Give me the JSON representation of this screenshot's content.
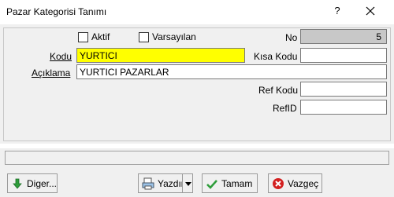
{
  "window": {
    "title": "Pazar Kategorisi Tanımı",
    "help_label": "?"
  },
  "form": {
    "aktif": {
      "label": "Aktif",
      "checked": false
    },
    "varsayilan": {
      "label": "Varsayılan",
      "checked": false
    },
    "no": {
      "label": "No",
      "value": "5"
    },
    "kodu": {
      "label": "Kodu",
      "value": "YURTICI"
    },
    "kisa_kodu": {
      "label": "Kısa Kodu",
      "value": ""
    },
    "aciklama": {
      "label": "Açıklama",
      "value": "YURTICI PAZARLAR"
    },
    "ref_kodu": {
      "label": "Ref Kodu",
      "value": ""
    },
    "ref_id": {
      "label": "RefID",
      "value": ""
    }
  },
  "status": {
    "text": ""
  },
  "buttons": {
    "diger": "Diger...",
    "yazdir": "Yazdır",
    "tamam": "Tamam",
    "vazgec": "Vazgeç"
  },
  "colors": {
    "kodu_field": "#ffff00",
    "no_field": "#c8c8c8",
    "panel": "#f0f0f0"
  }
}
